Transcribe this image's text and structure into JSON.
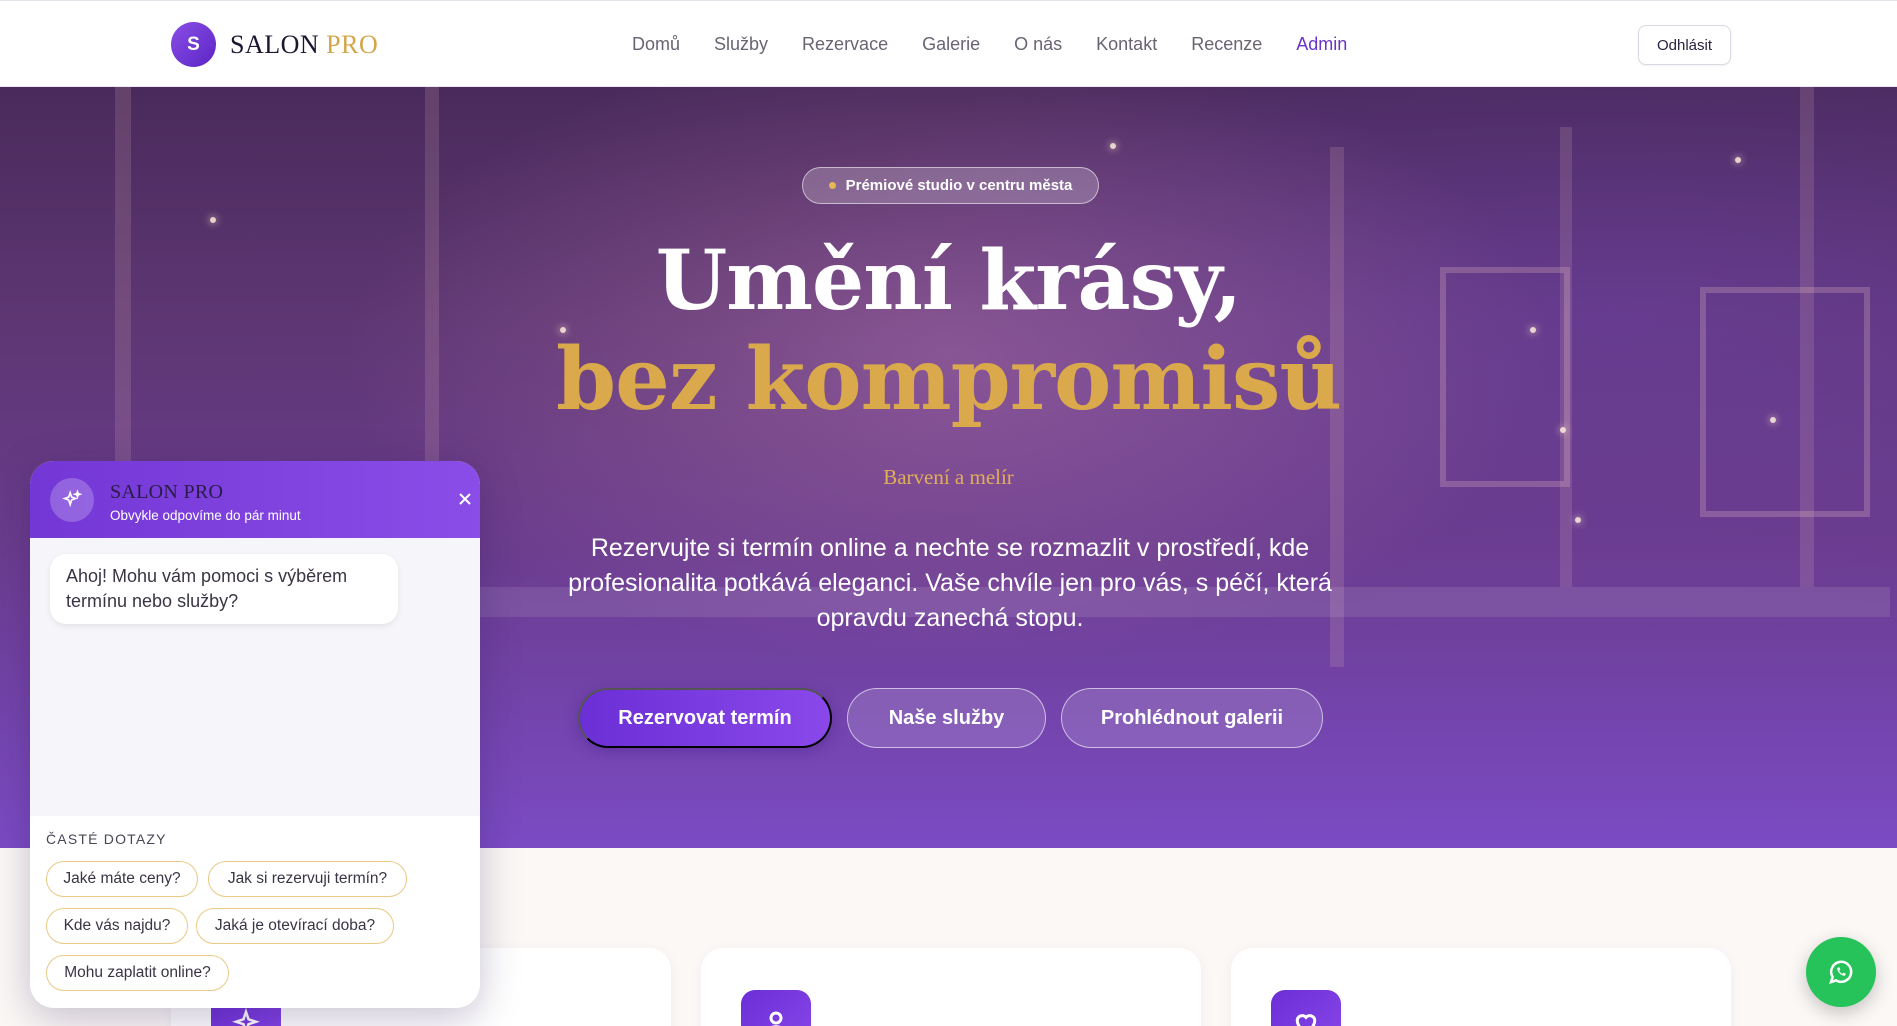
{
  "brand": {
    "initial": "S",
    "name_main": "SALON",
    "name_accent": "PRO"
  },
  "nav": {
    "items": [
      {
        "label": "Domů",
        "active": false
      },
      {
        "label": "Služby",
        "active": false
      },
      {
        "label": "Rezervace",
        "active": false
      },
      {
        "label": "Galerie",
        "active": false
      },
      {
        "label": "O nás",
        "active": false
      },
      {
        "label": "Kontakt",
        "active": false
      },
      {
        "label": "Recenze",
        "active": false
      },
      {
        "label": "Admin",
        "active": true
      }
    ],
    "logout_label": "Odhlásit"
  },
  "hero": {
    "badge": "Prémiové studio v centru města",
    "title_line1": "Umění krásy,",
    "title_line2": "bez kompromisů",
    "subtitle": "Barvení a melír",
    "description": "Rezervujte si termín online a nechte se rozmazlit v prostředí, kde profesionalita potkává eleganci. Vaše chvíle jen pro vás, s péčí, která opravdu zanechá stopu.",
    "buttons": {
      "primary": "Rezervovat termín",
      "services": "Naše služby",
      "gallery": "Prohlédnout galerii"
    }
  },
  "chat": {
    "title": "SALON PRO",
    "status": "Obvykle odpovíme do pár minut",
    "greeting": "Ahoj! Mohu vám pomoci s výběrem termínu nebo služby?",
    "faq_label": "ČASTÉ DOTAZY",
    "faq": [
      "Jaké máte ceny?",
      "Jak si rezervuji termín?",
      "Kde vás najdu?",
      "Jaká je otevírací doba?",
      "Mohu zaplatit online?"
    ]
  },
  "colors": {
    "brand_purple": "#6b2fd6",
    "gold_accent": "#d9a94c",
    "whatsapp_green": "#25c35a"
  },
  "icons": {
    "chat_avatar": "sparkles-icon",
    "chat_close": "close-icon",
    "whatsapp": "whatsapp-icon",
    "card_1": "sparkles-icon",
    "card_2": "user-icon",
    "card_3": "heart-icon"
  }
}
